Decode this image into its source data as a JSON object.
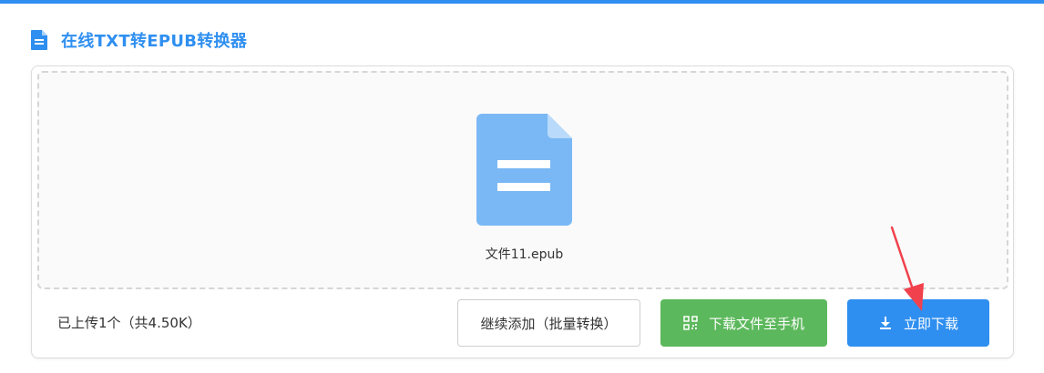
{
  "header": {
    "title": "在线TXT转EPUB转换器",
    "icon": "document-icon"
  },
  "dropzone": {
    "file_icon": "file-icon",
    "file_name": "文件11.epub"
  },
  "footer": {
    "status": "已上传1个（共4.50K）",
    "continue_label": "继续添加（批量转换）",
    "phone_label": "下载文件至手机",
    "phone_icon": "qrcode-icon",
    "download_label": "立即下载",
    "download_icon": "download-icon"
  },
  "colors": {
    "accent": "#2f8ff0",
    "green": "#5cb85c",
    "file_icon": "#7ab8f5",
    "arrow": "#f0414c"
  }
}
